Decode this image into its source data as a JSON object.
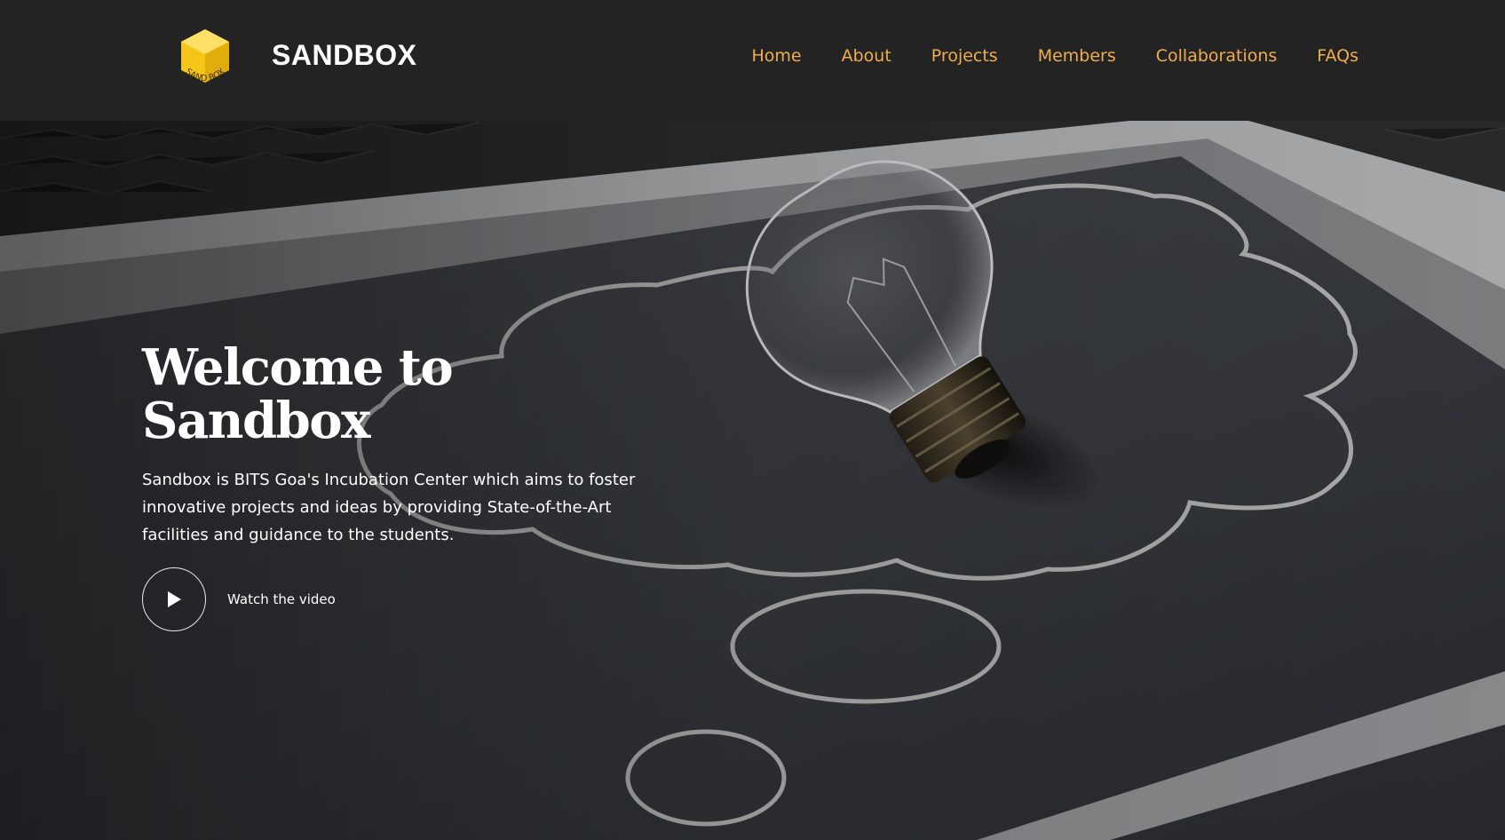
{
  "brand": {
    "name": "SANDBOX",
    "logo_text": "SAND BOX",
    "logo_color": "#f5c518"
  },
  "nav": {
    "items": [
      "Home",
      "About",
      "Projects",
      "Members",
      "Collaborations",
      "FAQs"
    ],
    "color": "#f0ad4e"
  },
  "hero": {
    "title_line1": "Welcome to",
    "title_line2": "Sandbox",
    "description": "Sandbox is BITS Goa's Incubation Center which aims to foster innovative projects and ideas by providing State-of-the-Art facilities and guidance to the students.",
    "video_label": "Watch the video",
    "play_icon": "play-icon",
    "background_image": "light bulb on chalkboard thought bubble"
  }
}
